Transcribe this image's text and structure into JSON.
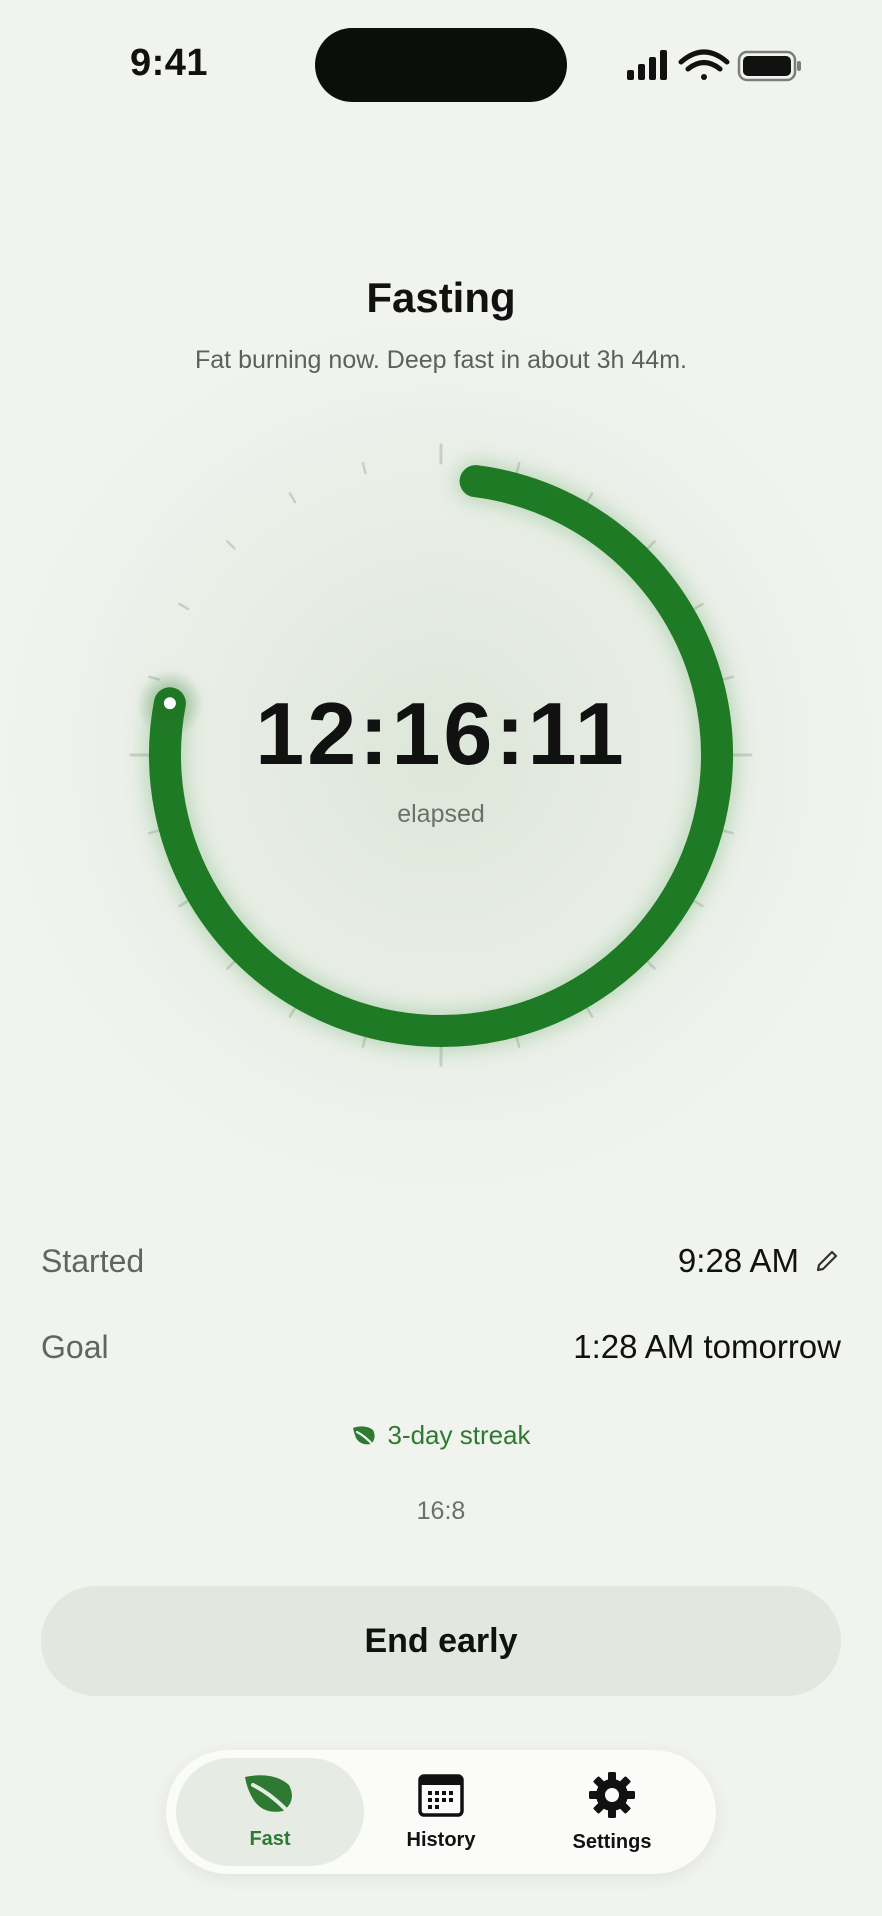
{
  "status_bar": {
    "time": "9:41"
  },
  "header": {
    "title": "Fasting",
    "subtitle": "Fat burning now. Deep fast in about 3h 44m."
  },
  "timer": {
    "value": "12:16:11",
    "caption": "elapsed",
    "progress_fraction": 0.76
  },
  "details": {
    "started_label": "Started",
    "started_value": "9:28 AM",
    "goal_label": "Goal",
    "goal_value": "1:28 AM tomorrow"
  },
  "streak": {
    "label": "3-day streak"
  },
  "plan": {
    "ratio": "16:8"
  },
  "actions": {
    "end_label": "End early"
  },
  "tabs": [
    {
      "label": "Fast",
      "icon": "leaf-icon",
      "active": true
    },
    {
      "label": "History",
      "icon": "calendar-icon",
      "active": false
    },
    {
      "label": "Settings",
      "icon": "gear-icon",
      "active": false
    }
  ],
  "colors": {
    "accent": "#2e7a32",
    "ring": "#1f7a26",
    "background": "#f1f3ef"
  }
}
